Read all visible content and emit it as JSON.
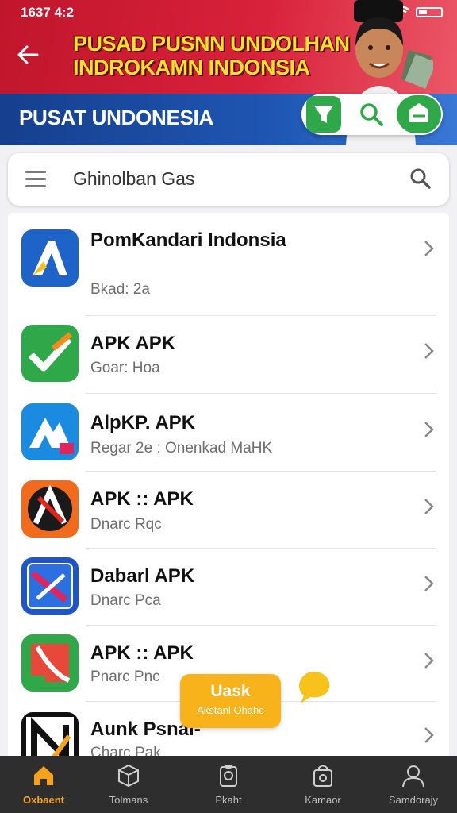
{
  "status_bar": {
    "time": "1637 4:2"
  },
  "banner": {
    "title": "PUSAD PUSNN UNDOLHAN INDROKAMN INDONSIA",
    "subtitle": "PUSAT UNDONESIA"
  },
  "search": {
    "value": "Ghinolban Gas"
  },
  "apps": [
    {
      "title": "PomKandari Indonsia",
      "subtitle": "Bkad: 2a",
      "icon": "blue-a-logo-icon"
    },
    {
      "title": "APK APK",
      "subtitle": "Goar: Hoa",
      "icon": "green-check-icon"
    },
    {
      "title": "AlpKP. APK",
      "subtitle": "Regar 2e : Onenkad MaHK",
      "icon": "blue-mountain-icon"
    },
    {
      "title": "APK :: APK",
      "subtitle": "Dnarc Rqc",
      "icon": "orange-a-icon"
    },
    {
      "title": "Dabarl APK",
      "subtitle": "Dnarc Pca",
      "icon": "blue-pen-icon"
    },
    {
      "title": "APK :: APK",
      "subtitle": "Pnarc Pnc",
      "icon": "green-orange-icon"
    },
    {
      "title": "Aunk Psnai-",
      "subtitle": "Charc Pak",
      "icon": "black-n-icon"
    }
  ],
  "floating_card": {
    "title": "Uask",
    "subtitle": "Akstanl Ohahc"
  },
  "nav": [
    {
      "label": "Oxbaent",
      "icon": "home-icon",
      "active": true
    },
    {
      "label": "Tolmans",
      "icon": "cube-icon",
      "active": false
    },
    {
      "label": "Pkaht",
      "icon": "clipboard-icon",
      "active": false
    },
    {
      "label": "Kamaor",
      "icon": "bag-icon",
      "active": false
    },
    {
      "label": "Samdorajy",
      "icon": "user-icon",
      "active": false
    }
  ],
  "colors": {
    "header_red": "#d8213a",
    "header_blue": "#1f56b3",
    "accent_orange": "#f7a21b",
    "accent_green": "#2fa84a"
  }
}
